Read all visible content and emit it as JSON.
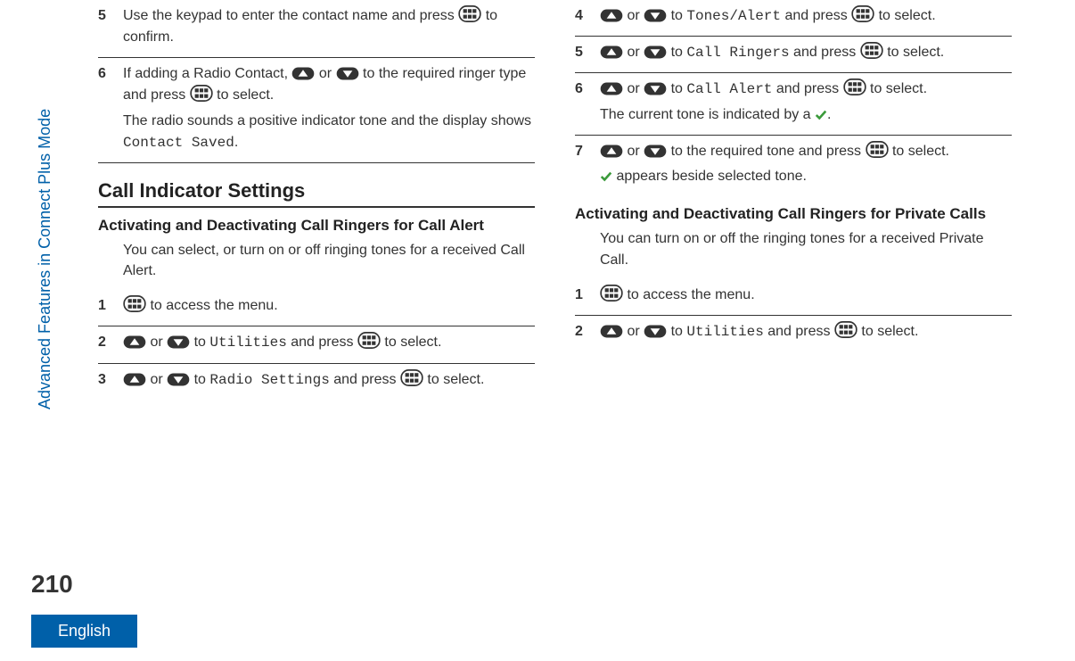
{
  "sidebar": {
    "label": "Advanced Features in Connect Plus Mode"
  },
  "page_number": "210",
  "language_tab": "English",
  "left": {
    "step5": {
      "before": "Use the keypad to enter the contact name and press ",
      "after": " to confirm."
    },
    "step6": {
      "t1": "If adding a Radio Contact, ",
      "t2": " or ",
      "t3": " to the required ringer type and press ",
      "t4": " to select.",
      "t5": "The radio sounds a positive indicator tone and the display shows ",
      "mono": "Contact Saved",
      "t6": "."
    },
    "h1": "Call Indicator Settings",
    "h2": "Activating and Deactivating Call Ringers for Call Alert",
    "intro": "You can select, or turn on or off ringing tones for a received Call Alert.",
    "s1": {
      "t1": " to access the menu."
    },
    "s2": {
      "t1": " or ",
      "t2": " to ",
      "mono": "Utilities",
      "t3": " and press ",
      "t4": " to select."
    },
    "s3": {
      "t1": " or ",
      "t2": " to ",
      "mono": "Radio Settings",
      "t3": " and press ",
      "t4": " to select."
    }
  },
  "right": {
    "s4": {
      "t1": " or ",
      "t2": " to ",
      "mono": "Tones/Alert",
      "t3": " and press ",
      "t4": " to select."
    },
    "s5": {
      "t1": " or ",
      "t2": " to ",
      "mono": "Call Ringers",
      "t3": " and press ",
      "t4": " to select."
    },
    "s6": {
      "t1": " or ",
      "t2": " to ",
      "mono": "Call Alert",
      "t3": " and press ",
      "t4": " to select.",
      "extra1": "The current tone is indicated by a ",
      "extra2": "."
    },
    "s7": {
      "t1": " or ",
      "t2": " to the required tone and press ",
      "t3": " to select.",
      "extra": " appears beside selected tone."
    },
    "h2b": "Activating and Deactivating Call Ringers for Private Calls",
    "intro2": "You can turn on or off the ringing tones for a received Private Call.",
    "b1": {
      "t1": " to access the menu."
    },
    "b2": {
      "t1": " or ",
      "t2": " to ",
      "mono": "Utilities",
      "t3": " and press ",
      "t4": " to select."
    }
  }
}
